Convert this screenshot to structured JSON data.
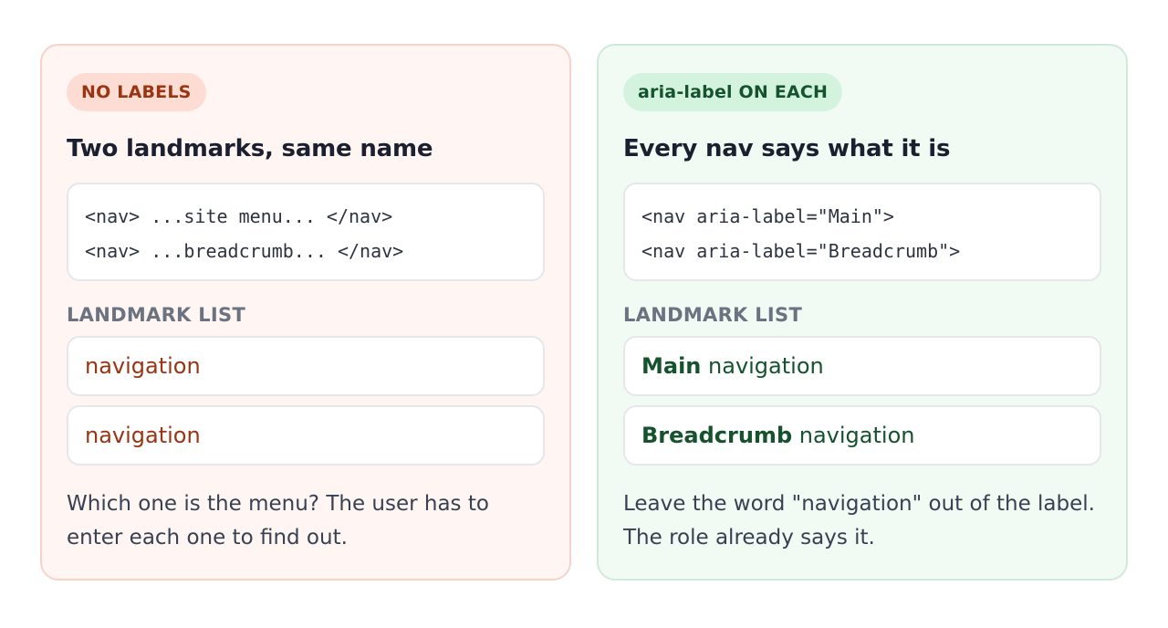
{
  "left": {
    "badge": "NO LABELS",
    "title": "Two landmarks, same name",
    "code": [
      "<nav> ...site menu... </nav>",
      "<nav> ...breadcrumb... </nav>"
    ],
    "list_label": "LANDMARK LIST",
    "items": [
      {
        "role": "navigation"
      },
      {
        "role": "navigation"
      }
    ],
    "note": "Which one is the menu? The user has to enter each one to find out.",
    "colors": {
      "bg": "#fff5f3",
      "border": "#f5d3cb",
      "accent": "#9a3412"
    }
  },
  "right": {
    "badge": "aria-label ON EACH",
    "title": "Every nav says what it is",
    "code": [
      "<nav aria-label=\"Main\">",
      "<nav aria-label=\"Breadcrumb\">"
    ],
    "list_label": "LANDMARK LIST",
    "items": [
      {
        "name": "Main",
        "role": " navigation"
      },
      {
        "name": "Breadcrumb",
        "role": " navigation"
      }
    ],
    "note": "Leave the word \"navigation\" out of the label. The role already says it.",
    "colors": {
      "bg": "#f1faf3",
      "border": "#cfeadb",
      "accent": "#14532d"
    }
  }
}
